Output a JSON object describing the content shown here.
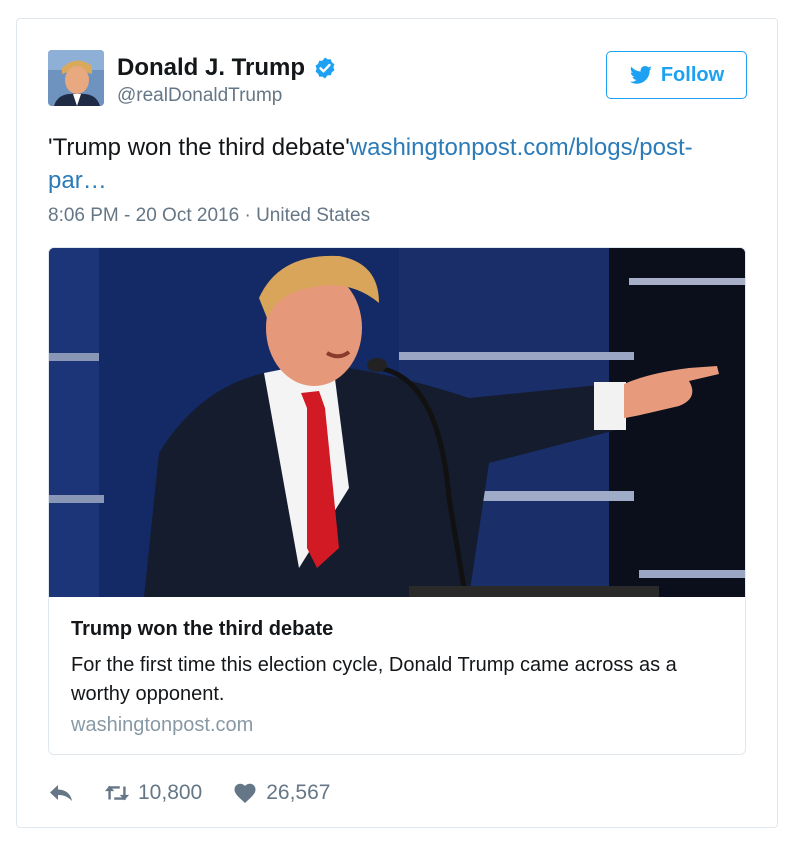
{
  "tweet": {
    "display_name": "Donald J. Trump",
    "handle": "@realDonaldTrump",
    "verified_icon": "verified-badge-icon",
    "follow_label": "Follow",
    "text": "'Trump won the third debate'",
    "link_text_line1": "washingtonpost.com/blogs/post-",
    "link_text_line2": "par…",
    "timestamp": "8:06 PM - 20 Oct 2016",
    "separator": "·",
    "location": "United States"
  },
  "card": {
    "title": "Trump won the third debate",
    "description": "For the first time this election cycle, Donald Trump came across as a worthy opponent.",
    "domain": "washingtonpost.com"
  },
  "actions": {
    "reply_icon": "reply-icon",
    "retweet_icon": "retweet-icon",
    "retweet_count": "10,800",
    "like_icon": "heart-icon",
    "like_count": "26,567"
  },
  "colors": {
    "accent": "#1da1f2",
    "link": "#2b7bb9",
    "muted": "#657786",
    "border": "#e1e8ed"
  }
}
